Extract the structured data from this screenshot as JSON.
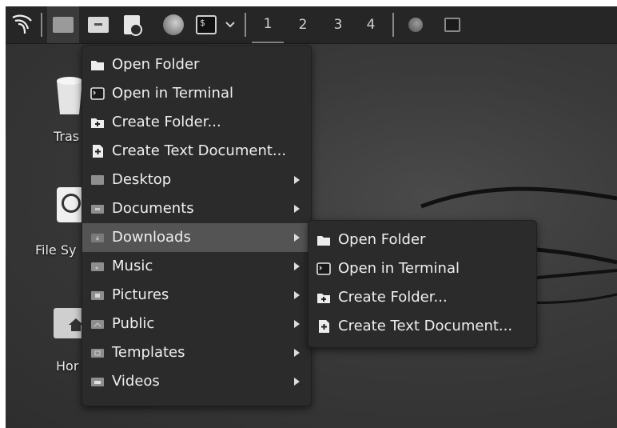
{
  "panel": {
    "workspaces": [
      "1",
      "2",
      "3",
      "4"
    ]
  },
  "desktop": {
    "icons": [
      {
        "label": "Tras"
      },
      {
        "label": "File Sy"
      },
      {
        "label": "Hor"
      }
    ]
  },
  "main_menu": {
    "items": [
      {
        "label": "Open Folder",
        "icon": "folder-icon"
      },
      {
        "label": "Open in Terminal",
        "icon": "terminal-icon"
      },
      {
        "label": "Create Folder...",
        "icon": "new-folder-icon"
      },
      {
        "label": "Create Text Document...",
        "icon": "new-document-icon"
      },
      {
        "label": "Desktop",
        "icon": "desktop-folder-icon",
        "submenu": true
      },
      {
        "label": "Documents",
        "icon": "documents-folder-icon",
        "submenu": true
      },
      {
        "label": "Downloads",
        "icon": "downloads-folder-icon",
        "submenu": true,
        "highlighted": true
      },
      {
        "label": "Music",
        "icon": "music-folder-icon",
        "submenu": true
      },
      {
        "label": "Pictures",
        "icon": "pictures-folder-icon",
        "submenu": true
      },
      {
        "label": "Public",
        "icon": "public-folder-icon",
        "submenu": true
      },
      {
        "label": "Templates",
        "icon": "templates-folder-icon",
        "submenu": true
      },
      {
        "label": "Videos",
        "icon": "videos-folder-icon",
        "submenu": true
      }
    ]
  },
  "submenu": {
    "items": [
      {
        "label": "Open Folder",
        "icon": "folder-icon"
      },
      {
        "label": "Open in Terminal",
        "icon": "terminal-icon"
      },
      {
        "label": "Create Folder...",
        "icon": "new-folder-icon"
      },
      {
        "label": "Create Text Document...",
        "icon": "new-document-icon"
      }
    ]
  },
  "colors": {
    "panel": "#262626",
    "menu": "#2b2b2b",
    "highlight": "#545454",
    "text": "#efefef"
  }
}
